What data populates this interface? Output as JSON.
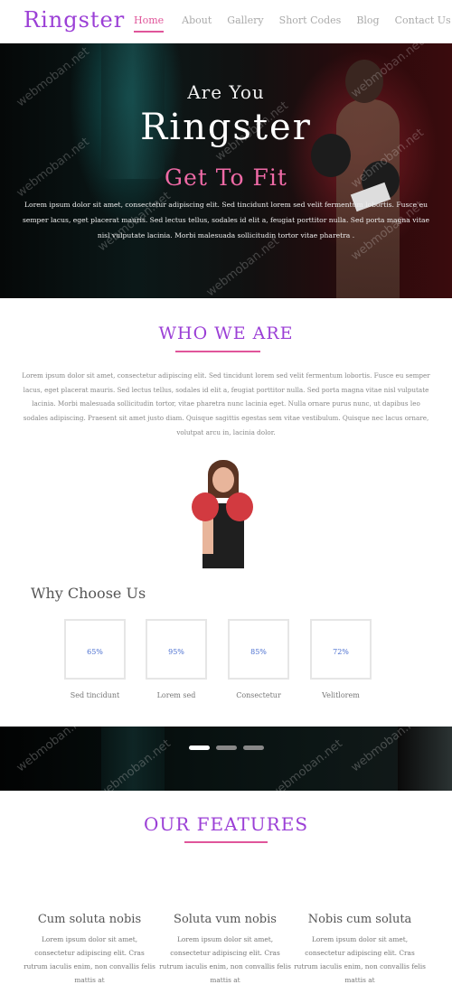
{
  "nav": {
    "logo": "Ringster",
    "items": [
      {
        "label": "Home",
        "active": true
      },
      {
        "label": "About",
        "active": false
      },
      {
        "label": "Gallery",
        "active": false
      },
      {
        "label": "Short Codes",
        "active": false
      },
      {
        "label": "Blog",
        "active": false
      },
      {
        "label": "Contact Us",
        "active": false
      }
    ]
  },
  "hero": {
    "subtitle": "Are You",
    "title": "Ringster",
    "tagline": "Get To Fit",
    "text": "Lorem ipsum dolor sit amet, consectetur adipiscing elit. Sed tincidunt lorem sed velit fermentum lobortis. Fusce eu semper lacus, eget placerat mauris. Sed lectus tellus, sodales id elit a, feugiat porttitor nulla. Sed porta magna vitae nisl vulputate lacinia. Morbi malesuada sollicitudin tortor vitae pharetra ."
  },
  "who": {
    "title": "WHO WE ARE",
    "text": "Lorem ipsum dolor sit amet, consectetur adipiscing elit. Sed tincidunt lorem sed velit fermentum lobortis. Fusce eu semper lacus, eget placerat mauris. Sed lectus tellus, sodales id elit a, feugiat porttitor nulla. Sed porta magna vitae nisl vulputate lacinia. Morbi malesuada sollicitudin tortor, vitae pharetra nunc lacinia eget. Nulla ornare purus nunc, ut dapibus leo sodales adipiscing. Praesent sit amet justo diam. Quisque sagittis egestas sem vitae vestibulum. Quisque nec lacus ornare, volutpat arcu in, lacinia dolor."
  },
  "why": {
    "title": "Why Choose Us",
    "stats": [
      {
        "value": "65%",
        "label": "Sed tincidunt"
      },
      {
        "value": "95%",
        "label": "Lorem sed"
      },
      {
        "value": "85%",
        "label": "Consectetur"
      },
      {
        "value": "72%",
        "label": "Velitlorem"
      }
    ]
  },
  "slider": {
    "dots": 3,
    "active_index": 0
  },
  "features": {
    "title": "OUR FEATURES",
    "columns": [
      {
        "title": "Cum soluta nobis",
        "text": "Lorem ipsum dolor sit amet, consectetur adipiscing elit. Cras rutrum iaculis enim, non convallis felis mattis at"
      },
      {
        "title": "Soluta vum nobis",
        "text": "Lorem ipsum dolor sit amet, consectetur adipiscing elit. Cras rutrum iaculis enim, non convallis felis mattis at"
      },
      {
        "title": "Nobis cum soluta",
        "text": "Lorem ipsum dolor sit amet, consectetur adipiscing elit. Cras rutrum iaculis enim, non convallis felis mattis at"
      }
    ]
  },
  "watermark": "webmoban.net",
  "colors": {
    "brand": "#9b3fd6",
    "accent": "#e0559a",
    "stat_value": "#4a6fd0"
  }
}
